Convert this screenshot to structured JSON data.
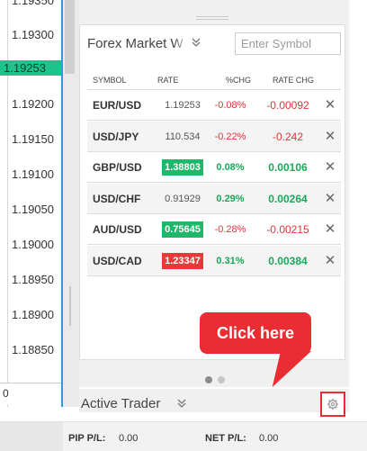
{
  "price_axis": {
    "labels": [
      "1.19350",
      "1.19300",
      "1.19200",
      "1.19150",
      "1.19100",
      "1.19050",
      "1.19000",
      "1.18950",
      "1.18900",
      "1.18850"
    ],
    "current_price": "1.19253",
    "current_price_color": "#1ec28b",
    "bottom_value": "0"
  },
  "watchlist": {
    "title": "Forex Market W",
    "search_placeholder": "Enter Symbol",
    "columns": {
      "symbol": "SYMBOL",
      "rate": "RATE",
      "pct_chg": "%CHG",
      "rate_chg": "RATE CHG"
    },
    "rows": [
      {
        "symbol": "EUR/USD",
        "rate": "1.19253",
        "rate_style": "plain",
        "pct_chg": "-0.08%",
        "rate_chg": "-0.00092",
        "direction": "neg"
      },
      {
        "symbol": "USD/JPY",
        "rate": "110.534",
        "rate_style": "plain",
        "pct_chg": "-0.22%",
        "rate_chg": "-0.242",
        "direction": "neg"
      },
      {
        "symbol": "GBP/USD",
        "rate": "1.38803",
        "rate_style": "up",
        "pct_chg": "0.08%",
        "rate_chg": "0.00106",
        "direction": "pos"
      },
      {
        "symbol": "USD/CHF",
        "rate": "0.91929",
        "rate_style": "plain",
        "pct_chg": "0.29%",
        "rate_chg": "0.00264",
        "direction": "pos"
      },
      {
        "symbol": "AUD/USD",
        "rate": "0.75645",
        "rate_style": "up",
        "pct_chg": "-0.28%",
        "rate_chg": "-0.00215",
        "direction": "neg"
      },
      {
        "symbol": "USD/CAD",
        "rate": "1.23347",
        "rate_style": "down",
        "pct_chg": "0.31%",
        "rate_chg": "0.00384",
        "direction": "pos"
      }
    ],
    "remove_glyph": "✕",
    "colors": {
      "negative": "#e0343a",
      "positive": "#1aa859",
      "rate_up_bg": "#1eb86a",
      "rate_down_bg": "#e33b3b"
    },
    "page_count": 2,
    "active_page": 1
  },
  "callout": {
    "text": "Click here",
    "color": "#ea2d33"
  },
  "active_trader": {
    "label": "Active Trader",
    "chevron_icon": "double-chevron-down-icon",
    "settings_icon": "gear-icon"
  },
  "status": {
    "pip_label": "PIP P/L:",
    "pip_value": "0.00",
    "net_label": "NET P/L:",
    "net_value": "0.00"
  }
}
